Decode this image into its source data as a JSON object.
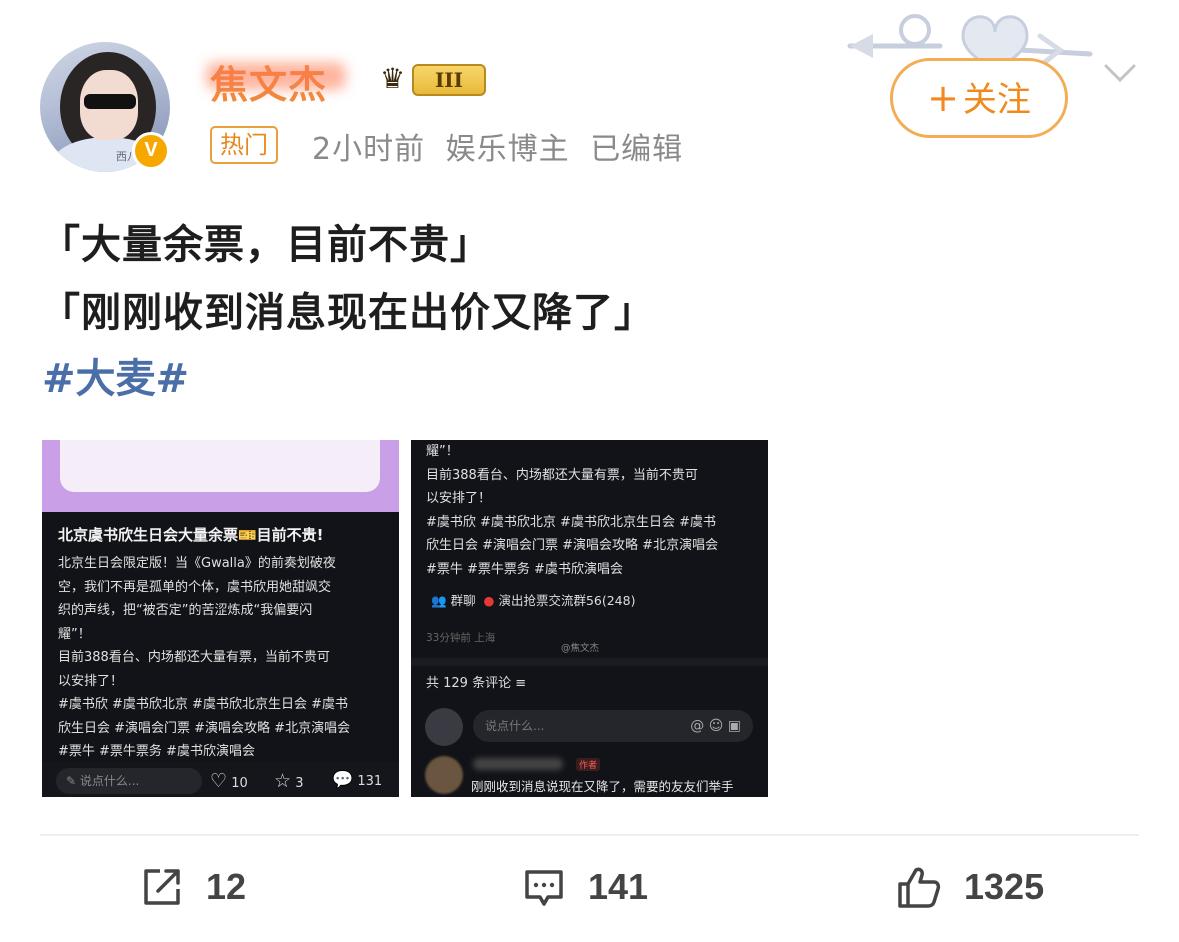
{
  "header": {
    "username": "焦文杰",
    "level_badge": "III",
    "verified_mark": "V",
    "avatar_tag": "西八",
    "hot_tag": "热门",
    "time": "2小时前",
    "role": "娱乐博主",
    "edited": "已编辑",
    "follow_label": "关注",
    "follow_plus": "+"
  },
  "post": {
    "line1": "「大量余票，目前不贵」",
    "line2": "「刚刚收到消息现在出价又降了」",
    "hashtag": "#大麦#"
  },
  "image1": {
    "title": "北京虞书欣生日会大量余票🎫目前不贵!",
    "body": "北京生日会限定版！当《Gwalla》的前奏划破夜\n空，我们不再是孤单的个体，虞书欣用她甜飒交\n织的声线，把“被否定”的苦涩炼成“我偏要闪\n耀”！\n目前388看台、内场都还大量有票，当前不贵可\n以安排了！\n#虞书欣 #虞书欣北京 #虞书欣北京生日会 #虞书\n欣生日会 #演唱会门票 #演唱会攻略 #北京演唱会\n#票牛 #票牛票务 #虞书欣演唱会",
    "input_placeholder": "说点什么...",
    "likes": "10",
    "favorites": "3",
    "comments": "131"
  },
  "image2": {
    "body": "耀”！\n目前388看台、内场都还大量有票，当前不贵可\n以安排了！\n#虞书欣 #虞书欣北京 #虞书欣北京生日会 #虞书\n欣生日会 #演唱会门票 #演唱会攻略 #北京演唱会\n#票牛 #票牛票务 #虞书欣演唱会",
    "group_label": "群聊",
    "group_name": "演出抢票交流群56(248)",
    "time_location": "33分钟前 上海",
    "watermark": "@焦文杰",
    "comment_count": "共 129 条评论",
    "comment_placeholder": "说点什么...",
    "author_tag": "作者",
    "comment_text": "刚刚收到消息说现在又降了，需要的友友们举手"
  },
  "actions": {
    "shares": "12",
    "comments": "141",
    "likes": "1325"
  },
  "colors": {
    "accent_orange": "#f08a1f",
    "hashtag_blue": "#4a6ea8",
    "meta_gray": "#8a8a8a"
  },
  "icons": [
    "share-icon",
    "comment-icon",
    "like-icon",
    "chevron-down-icon",
    "verified-icon",
    "crown-icon"
  ]
}
